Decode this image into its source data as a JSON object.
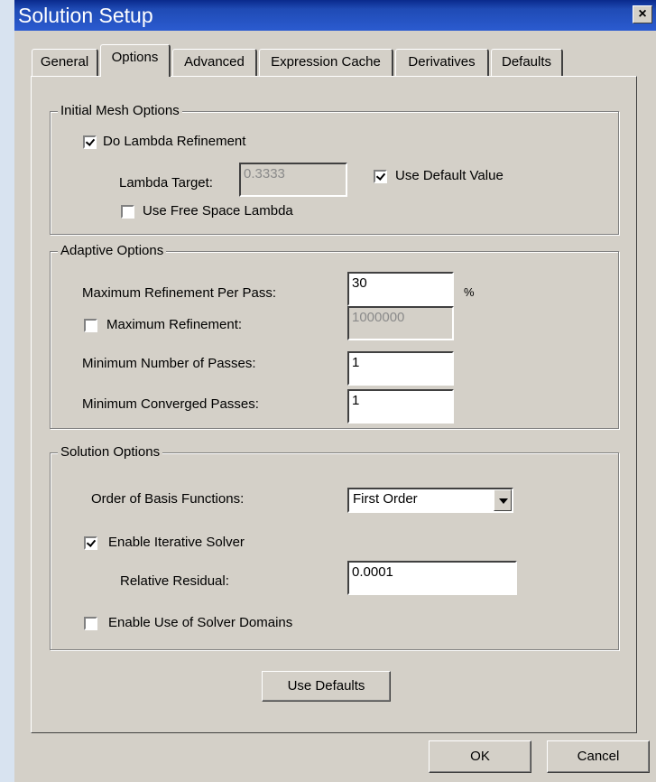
{
  "window": {
    "title": "Solution Setup",
    "close_label": "×"
  },
  "tabs": [
    "General",
    "Options",
    "Advanced",
    "Expression Cache",
    "Derivatives",
    "Defaults"
  ],
  "initial_mesh": {
    "group_label": "Initial Mesh Options",
    "do_lambda_refinement": {
      "label": "Do Lambda Refinement",
      "checked": true
    },
    "lambda_target": {
      "label": "Lambda Target:",
      "value": "0.3333",
      "disabled": true
    },
    "use_default_value": {
      "label": "Use Default Value",
      "checked": true
    },
    "use_free_space_lambda": {
      "label": "Use Free Space Lambda",
      "checked": false
    }
  },
  "adaptive": {
    "group_label": "Adaptive Options",
    "max_refinement_per_pass": {
      "label": "Maximum Refinement Per Pass:",
      "value": "30",
      "unit": "%"
    },
    "max_refinement": {
      "label": "Maximum Refinement:",
      "value": "1000000",
      "checked": false,
      "disabled": true
    },
    "min_passes": {
      "label": "Minimum Number of Passes:",
      "value": "1"
    },
    "min_converged_passes": {
      "label": "Minimum Converged Passes:",
      "value": "1"
    }
  },
  "solution": {
    "group_label": "Solution Options",
    "basis_order": {
      "label": "Order of Basis Functions:",
      "value": "First Order"
    },
    "iterative_solver": {
      "label": "Enable Iterative Solver",
      "checked": true
    },
    "relative_residual": {
      "label": "Relative Residual:",
      "value": "0.0001"
    },
    "solver_domains": {
      "label": "Enable Use of Solver Domains",
      "checked": false
    }
  },
  "buttons": {
    "use_defaults": "Use Defaults",
    "ok": "OK",
    "cancel": "Cancel"
  }
}
